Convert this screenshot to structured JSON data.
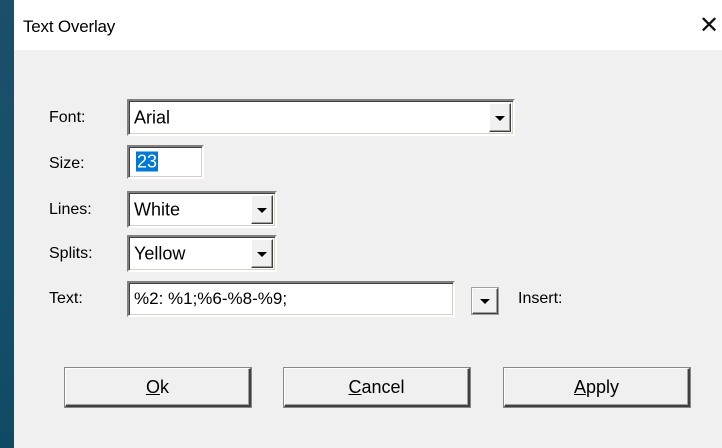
{
  "window": {
    "title": "Text Overlay",
    "close_glyph": "✕"
  },
  "form": {
    "font": {
      "label": "Font:",
      "value": "Arial"
    },
    "size": {
      "label": "Size:",
      "value": "23"
    },
    "lines": {
      "label": "Lines:",
      "value": "White"
    },
    "splits": {
      "label": "Splits:",
      "value": "Yellow"
    },
    "text": {
      "label": "Text:",
      "value": "%2: %1;%6-%8-%9;",
      "insert_label": "Insert:"
    }
  },
  "buttons": {
    "ok": {
      "mnemonic": "O",
      "rest": "k"
    },
    "cancel": {
      "mnemonic": "C",
      "rest": "ancel"
    },
    "apply": {
      "mnemonic": "A",
      "rest": "pply"
    }
  },
  "colors": {
    "selection": "#0078d7",
    "dialog_bg": "#f0f0f0",
    "desktop_bg": "#15506b"
  }
}
